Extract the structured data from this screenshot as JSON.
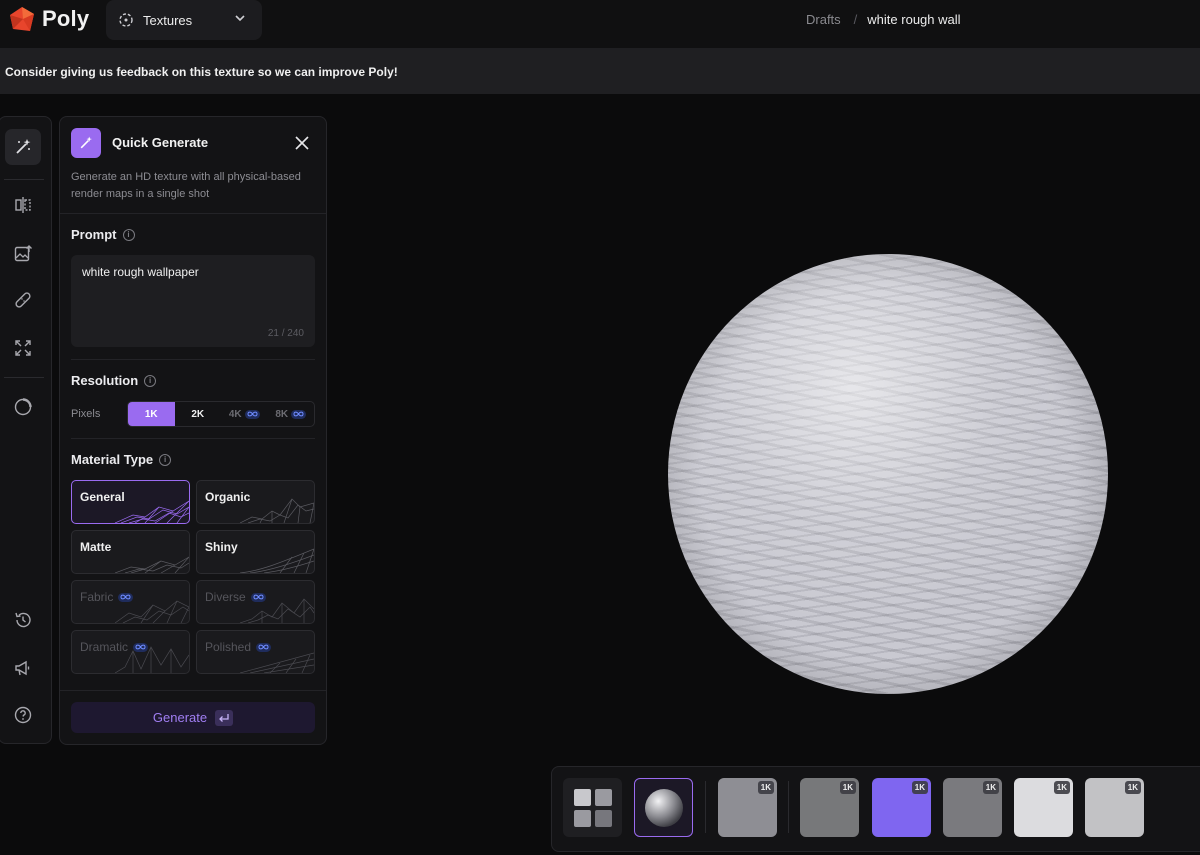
{
  "app": {
    "name": "Poly"
  },
  "product_select": {
    "label": "Textures",
    "icon": "textures-icon"
  },
  "breadcrumb": {
    "parent": "Drafts",
    "separator": "/",
    "current": "white rough wall"
  },
  "feedback": {
    "text": "Consider giving us feedback on this texture so we can improve Poly!"
  },
  "rail": {
    "top_icons": [
      "magic-wand-icon",
      "compare-icon",
      "image-upload-icon",
      "bandage-icon",
      "expand-icon",
      "circle-icon"
    ],
    "bottom_icons": [
      "history-icon",
      "megaphone-icon",
      "help-icon"
    ]
  },
  "panel": {
    "title": "Quick Generate",
    "description": "Generate an HD texture with all physical-based render maps in a single shot",
    "prompt": {
      "label": "Prompt",
      "value": "white rough wallpaper",
      "count": "21 / 240"
    },
    "resolution": {
      "label": "Resolution",
      "pixels_label": "Pixels",
      "options": [
        {
          "label": "1K",
          "selected": true,
          "locked": false
        },
        {
          "label": "2K",
          "selected": false,
          "locked": false
        },
        {
          "label": "4K",
          "selected": false,
          "locked": true
        },
        {
          "label": "8K",
          "selected": false,
          "locked": true
        }
      ]
    },
    "material_type": {
      "label": "Material Type",
      "options": [
        {
          "label": "General",
          "selected": true,
          "locked": false
        },
        {
          "label": "Organic",
          "selected": false,
          "locked": false
        },
        {
          "label": "Matte",
          "selected": false,
          "locked": false
        },
        {
          "label": "Shiny",
          "selected": false,
          "locked": false
        },
        {
          "label": "Fabric",
          "selected": false,
          "locked": true
        },
        {
          "label": "Diverse",
          "selected": false,
          "locked": true
        },
        {
          "label": "Dramatic",
          "selected": false,
          "locked": true
        },
        {
          "label": "Polished",
          "selected": false,
          "locked": true
        }
      ]
    },
    "generate_label": "Generate"
  },
  "tray": {
    "maps": [
      {
        "badge": "1K",
        "color": "#8e8e94"
      },
      {
        "badge": "1K",
        "color": "#77787a"
      },
      {
        "badge": "1K",
        "color": "#7f66f0"
      },
      {
        "badge": "1K",
        "color": "#7a7a7e"
      },
      {
        "badge": "1K",
        "color": "#dcdcdf"
      },
      {
        "badge": "1K",
        "color": "#c2c2c5"
      }
    ]
  },
  "colors": {
    "accent": "#9a6bf0",
    "background": "#0b0b0c",
    "panel": "#131315"
  }
}
